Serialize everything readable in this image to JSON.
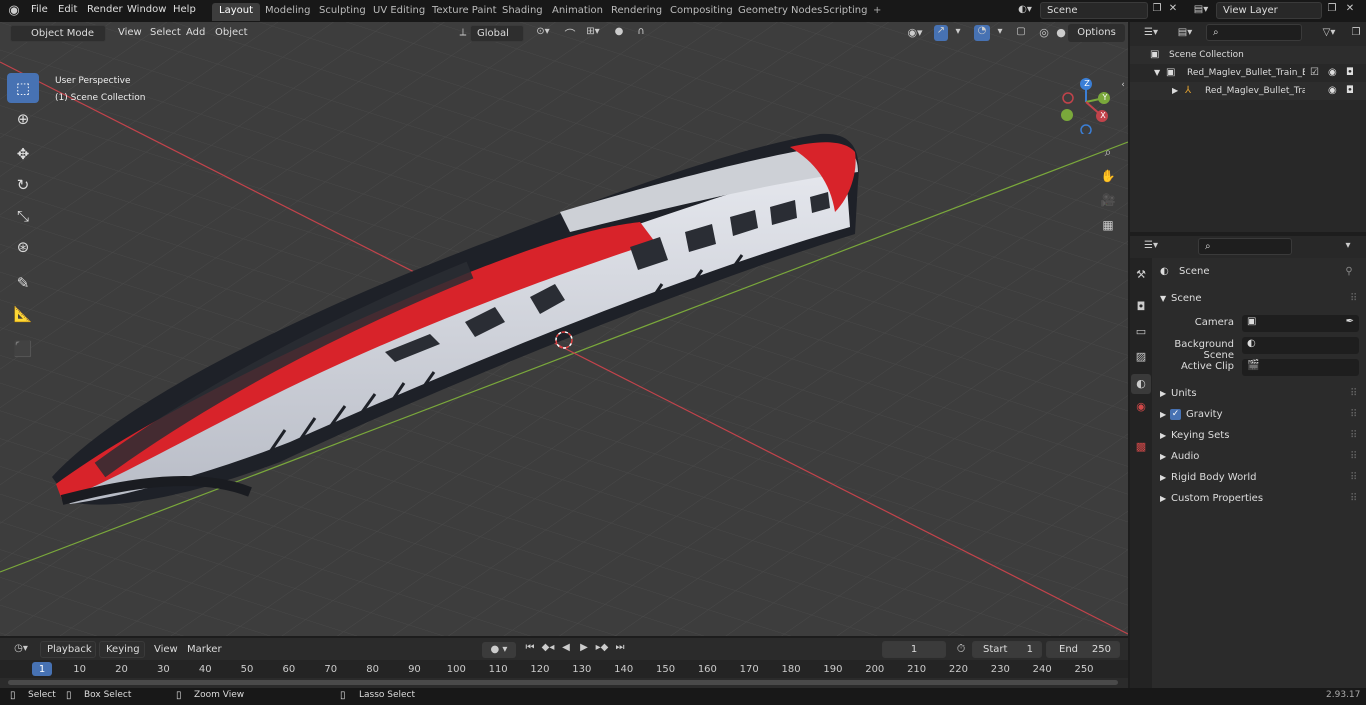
{
  "menubar": {
    "items": [
      "File",
      "Edit",
      "Render",
      "Window",
      "Help"
    ],
    "workspaces": [
      "Layout",
      "Modeling",
      "Sculpting",
      "UV Editing",
      "Texture Paint",
      "Shading",
      "Animation",
      "Rendering",
      "Compositing",
      "Geometry Nodes",
      "Scripting"
    ],
    "active_workspace": "Layout",
    "add_tab": "+",
    "scene_field": "Scene",
    "view_layer_field": "View Layer"
  },
  "viewport_header": {
    "mode": "Object Mode",
    "menus": [
      "View",
      "Select",
      "Add",
      "Object"
    ],
    "transform_orientation": "Global",
    "options": "Options"
  },
  "viewport": {
    "perspective_label": "User Perspective",
    "collection_label": "(1) Scene Collection",
    "gizmo_axes": {
      "z": "Z",
      "y": "Y",
      "x": "X"
    }
  },
  "outliner": {
    "root": "Scene Collection",
    "collection": "Red_Maglev_Bullet_Train_Eng",
    "object": "Red_Maglev_Bullet_Trair"
  },
  "properties": {
    "header_scene": "Scene",
    "panel_title": "Scene",
    "fields": [
      {
        "label": "Camera"
      },
      {
        "label": "Background Scene"
      },
      {
        "label": "Active Clip"
      }
    ],
    "sections": [
      "Units",
      "Gravity",
      "Keying Sets",
      "Audio",
      "Rigid Body World",
      "Custom Properties"
    ],
    "gravity_checked": true
  },
  "timeline": {
    "menus": [
      "Playback",
      "Keying",
      "View",
      "Marker"
    ],
    "current_frame": "1",
    "start_label": "Start",
    "start_value": "1",
    "end_label": "End",
    "end_value": "250",
    "ticks": [
      "1",
      "10",
      "20",
      "30",
      "40",
      "50",
      "60",
      "70",
      "80",
      "90",
      "100",
      "110",
      "120",
      "130",
      "140",
      "150",
      "160",
      "170",
      "180",
      "190",
      "200",
      "210",
      "220",
      "230",
      "240",
      "250"
    ]
  },
  "statusbar": {
    "select": "Select",
    "box_select": "Box Select",
    "zoom_view": "Zoom View",
    "lasso_select": "Lasso Select",
    "version": "2.93.17"
  },
  "colors": {
    "accent": "#4772b3",
    "axis_x": "#c2434b",
    "axis_y": "#7aa83b",
    "train_red": "#d8232a",
    "train_white": "#d9dce2",
    "train_dark": "#1e2128"
  }
}
